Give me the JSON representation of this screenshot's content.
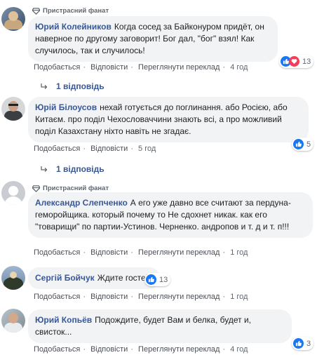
{
  "colors": {
    "link": "#385898",
    "like": "#1877f2",
    "love": "#f33e58",
    "bubble": "#f2f3f5"
  },
  "icons": {
    "badge": "diamond-icon",
    "reply_arrow": "reply-arrow-icon",
    "like": "like-icon",
    "love": "love-icon"
  },
  "comments": [
    {
      "badge": "Пристрасний фанат",
      "author": "Юрий Колейников",
      "text": "Когда сосед за Байконуром придёт, он наверное по другому заговорит! Бог дал, \"бог\" взял! Как случилось, так и случилось!",
      "like": "Подобається",
      "reply": "Відповісти",
      "translate": "Переглянути переклад",
      "time": "4 год",
      "reactions": "13",
      "replies": "1 відповідь"
    },
    {
      "author": "Юрій Білоусов",
      "text": "нехай готується до поглинання. або Росією, або Китаєм. про поділ Чехословаччини знають всі, а про можливий поділ Казахстану ніхто навіть не згадає.",
      "like": "Подобається",
      "reply": "Відповісти",
      "time": "5 год",
      "reactions": "5",
      "replies": "1 відповідь"
    },
    {
      "badge": "Пристрасний фанат",
      "author": "Александр Слепченко",
      "text": "А его уже давно все считают за пердуна-геморойщика. который почему то Не сдохнет никак. как его \"товарищи\" по партии-Устинов. Черненко. андропов и т. д и т. п!!!",
      "like": "Подобається",
      "reply": "Відповісти",
      "translate": "Переглянути переклад",
      "time": "1 год"
    },
    {
      "author": "Сергій Бойчук",
      "text": "Ждите гостей.",
      "like": "Подобається",
      "reply": "Відповісти",
      "translate": "Переглянути переклад",
      "time": "1 год",
      "reactions": "13"
    },
    {
      "author": "Юрий Копьёв",
      "text": "Подождите, будет Вам и белка, будет и, свисток...",
      "like": "Подобається",
      "reply": "Відповісти",
      "translate": "Переглянути переклад",
      "time": "4 год",
      "reactions": "3"
    }
  ]
}
